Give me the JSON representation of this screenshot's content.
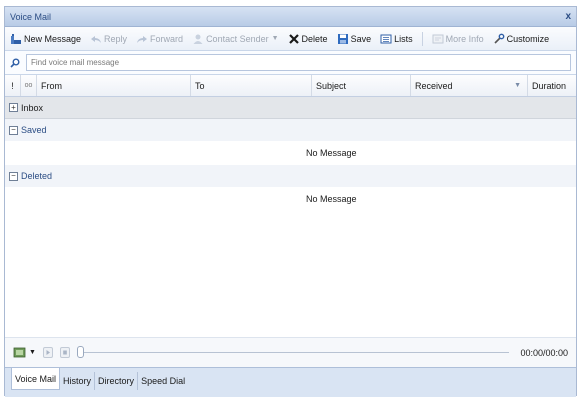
{
  "window": {
    "title": "Voice Mail",
    "close_glyph": "x"
  },
  "toolbar": {
    "new_message": "New Message",
    "reply": "Reply",
    "forward": "Forward",
    "contact_sender": "Contact Sender",
    "delete": "Delete",
    "save": "Save",
    "lists": "Lists",
    "more_info": "More Info",
    "customize": "Customize"
  },
  "search": {
    "placeholder": "Find voice mail message"
  },
  "columns": {
    "importance_glyph": "!",
    "attachment_glyph": "oo",
    "from": "From",
    "to": "To",
    "subject": "Subject",
    "received": "Received",
    "sort_glyph": "▼",
    "duration": "Duration"
  },
  "groups": {
    "inbox": {
      "label": "Inbox",
      "toggle": "+"
    },
    "saved": {
      "label": "Saved",
      "toggle": "−",
      "empty_text": "No Message"
    },
    "deleted": {
      "label": "Deleted",
      "toggle": "−",
      "empty_text": "No Message"
    }
  },
  "player": {
    "time": "00:00/00:00"
  },
  "tabs": [
    "Voice Mail",
    "History",
    "Directory",
    "Speed Dial"
  ],
  "colors": {
    "accent": "#2b4d84",
    "delete_red": "#1a1a1a",
    "save_blue": "#2f6bbf"
  }
}
